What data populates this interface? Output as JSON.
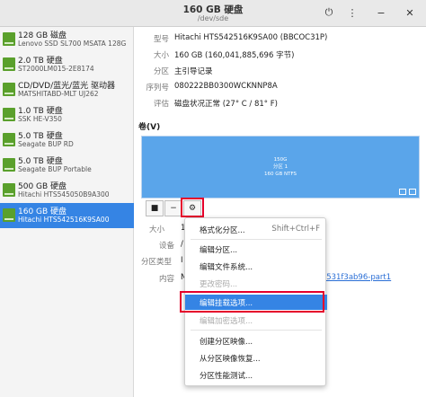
{
  "window": {
    "title": "160 GB 硬盘",
    "subtitle": "/dev/sde",
    "icons": [
      "power-icon",
      "menu-icon",
      "minimize-icon",
      "close-icon"
    ]
  },
  "sidebar": {
    "items": [
      {
        "name": "128 GB 磁盘",
        "model": "Lenovo SSD SL700 MSATA 128G",
        "selected": false
      },
      {
        "name": "2.0 TB 硬盘",
        "model": "ST2000LM015-2E8174",
        "selected": false
      },
      {
        "name": "CD/DVD/蓝光/蓝光 驱动器",
        "model": "MATSHITABD-MLT UJ262",
        "selected": false
      },
      {
        "name": "1.0 TB 硬盘",
        "model": "SSK HE-V350",
        "selected": false
      },
      {
        "name": "5.0 TB 硬盘",
        "model": "Seagate BUP RD",
        "selected": false
      },
      {
        "name": "5.0 TB 硬盘",
        "model": "Seagate BUP Portable",
        "selected": false
      },
      {
        "name": "500 GB 硬盘",
        "model": "Hitachi HTS545050B9A300",
        "selected": false
      },
      {
        "name": "160 GB 硬盘",
        "model": "Hitachi HTS542516K9SA00",
        "selected": true
      }
    ]
  },
  "info": {
    "rows": [
      {
        "label": "型号",
        "value": "Hitachi HTS542516K9SA00 (BBCOC31P)"
      },
      {
        "label": "大小",
        "value": "160 GB (160,041,885,696 字节)"
      },
      {
        "label": "分区",
        "value": "主引导记录"
      },
      {
        "label": "序列号",
        "value": "080222BB0300WCKNNP8A"
      },
      {
        "label": "评估",
        "value": "磁盘状况正常 (27° C / 81° F)"
      }
    ]
  },
  "volumes": {
    "title": "卷(V)",
    "bar_lines": [
      "150G",
      "分区 1",
      "160 GB NTFS"
    ],
    "toolbar": {
      "stop": "■",
      "minus": "−",
      "gear": "⚙"
    }
  },
  "details": {
    "rows": [
      {
        "label": "大小",
        "value": "1"
      },
      {
        "label": "设备",
        "value": "/"
      },
      {
        "label": "分区类型",
        "value": "I"
      },
      {
        "label": "内容",
        "value": "N"
      }
    ],
    "link_fragment": "a531f3ab96-part1"
  },
  "menu": {
    "items": [
      {
        "label": "格式化分区...",
        "shortcut": "Shift+Ctrl+F",
        "disabled": false,
        "highlight": false
      },
      {
        "label": "编辑分区...",
        "shortcut": "",
        "disabled": false,
        "highlight": false
      },
      {
        "label": "编辑文件系统...",
        "shortcut": "",
        "disabled": false,
        "highlight": false
      },
      {
        "label": "更改密码...",
        "shortcut": "",
        "disabled": true,
        "highlight": false
      },
      {
        "label": "编辑挂载选项...",
        "shortcut": "",
        "disabled": false,
        "highlight": true
      },
      {
        "label": "编辑加密选项...",
        "shortcut": "",
        "disabled": true,
        "highlight": false
      },
      {
        "label": "创建分区映像...",
        "shortcut": "",
        "disabled": false,
        "highlight": false
      },
      {
        "label": "从分区映像恢复...",
        "shortcut": "",
        "disabled": false,
        "highlight": false
      },
      {
        "label": "分区性能测试...",
        "shortcut": "",
        "disabled": false,
        "highlight": false
      }
    ]
  },
  "colors": {
    "accent": "#3584e4",
    "volume_fill": "#5aa5ea",
    "annotation_red": "#e5002b",
    "disk_icon_green": "#5aa02c"
  }
}
